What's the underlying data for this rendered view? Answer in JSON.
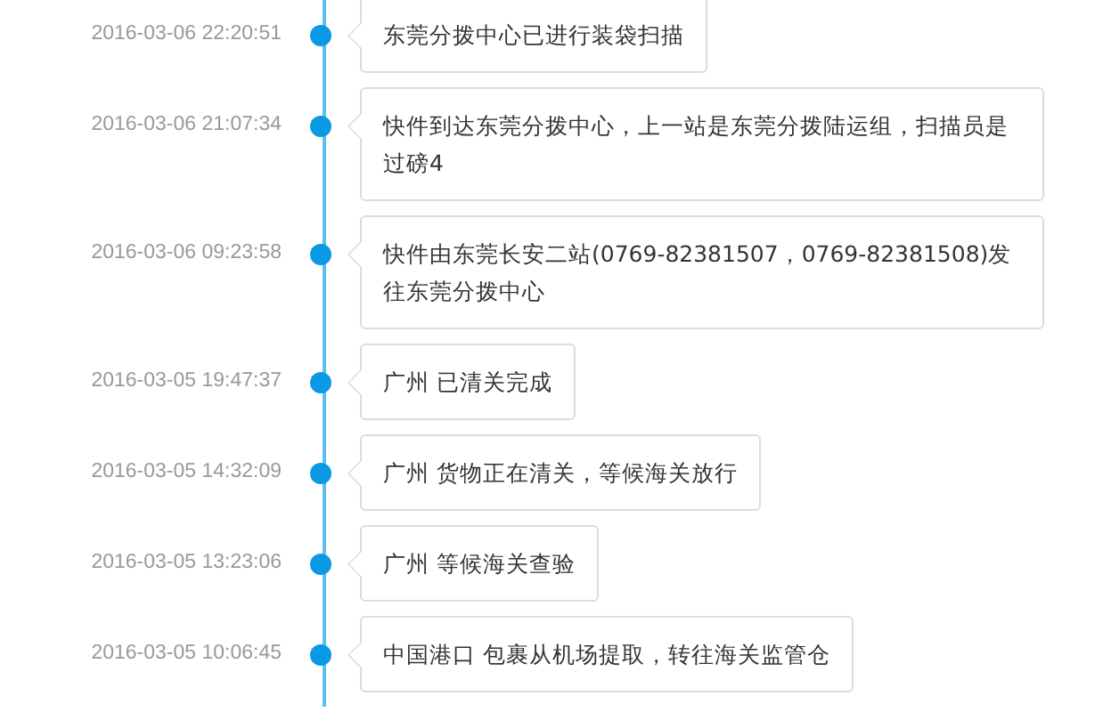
{
  "events": [
    {
      "time": "2016-03-06 22:20:51",
      "text": "东莞分拨中心已进行装袋扫描"
    },
    {
      "time": "2016-03-06 21:07:34",
      "text": "快件到达东莞分拨中心，上一站是东莞分拨陆运组，扫描员是过磅4"
    },
    {
      "time": "2016-03-06 09:23:58",
      "text": "快件由东莞长安二站(0769-82381507，0769-82381508)发往东莞分拨中心"
    },
    {
      "time": "2016-03-05 19:47:37",
      "text": "广州 已清关完成"
    },
    {
      "time": "2016-03-05 14:32:09",
      "text": "广州 货物正在清关，等候海关放行"
    },
    {
      "time": "2016-03-05 13:23:06",
      "text": "广州 等候海关查验"
    },
    {
      "time": "2016-03-05 10:06:45",
      "text": "中国港口 包裹从机场提取，转往海关监管仓"
    }
  ]
}
